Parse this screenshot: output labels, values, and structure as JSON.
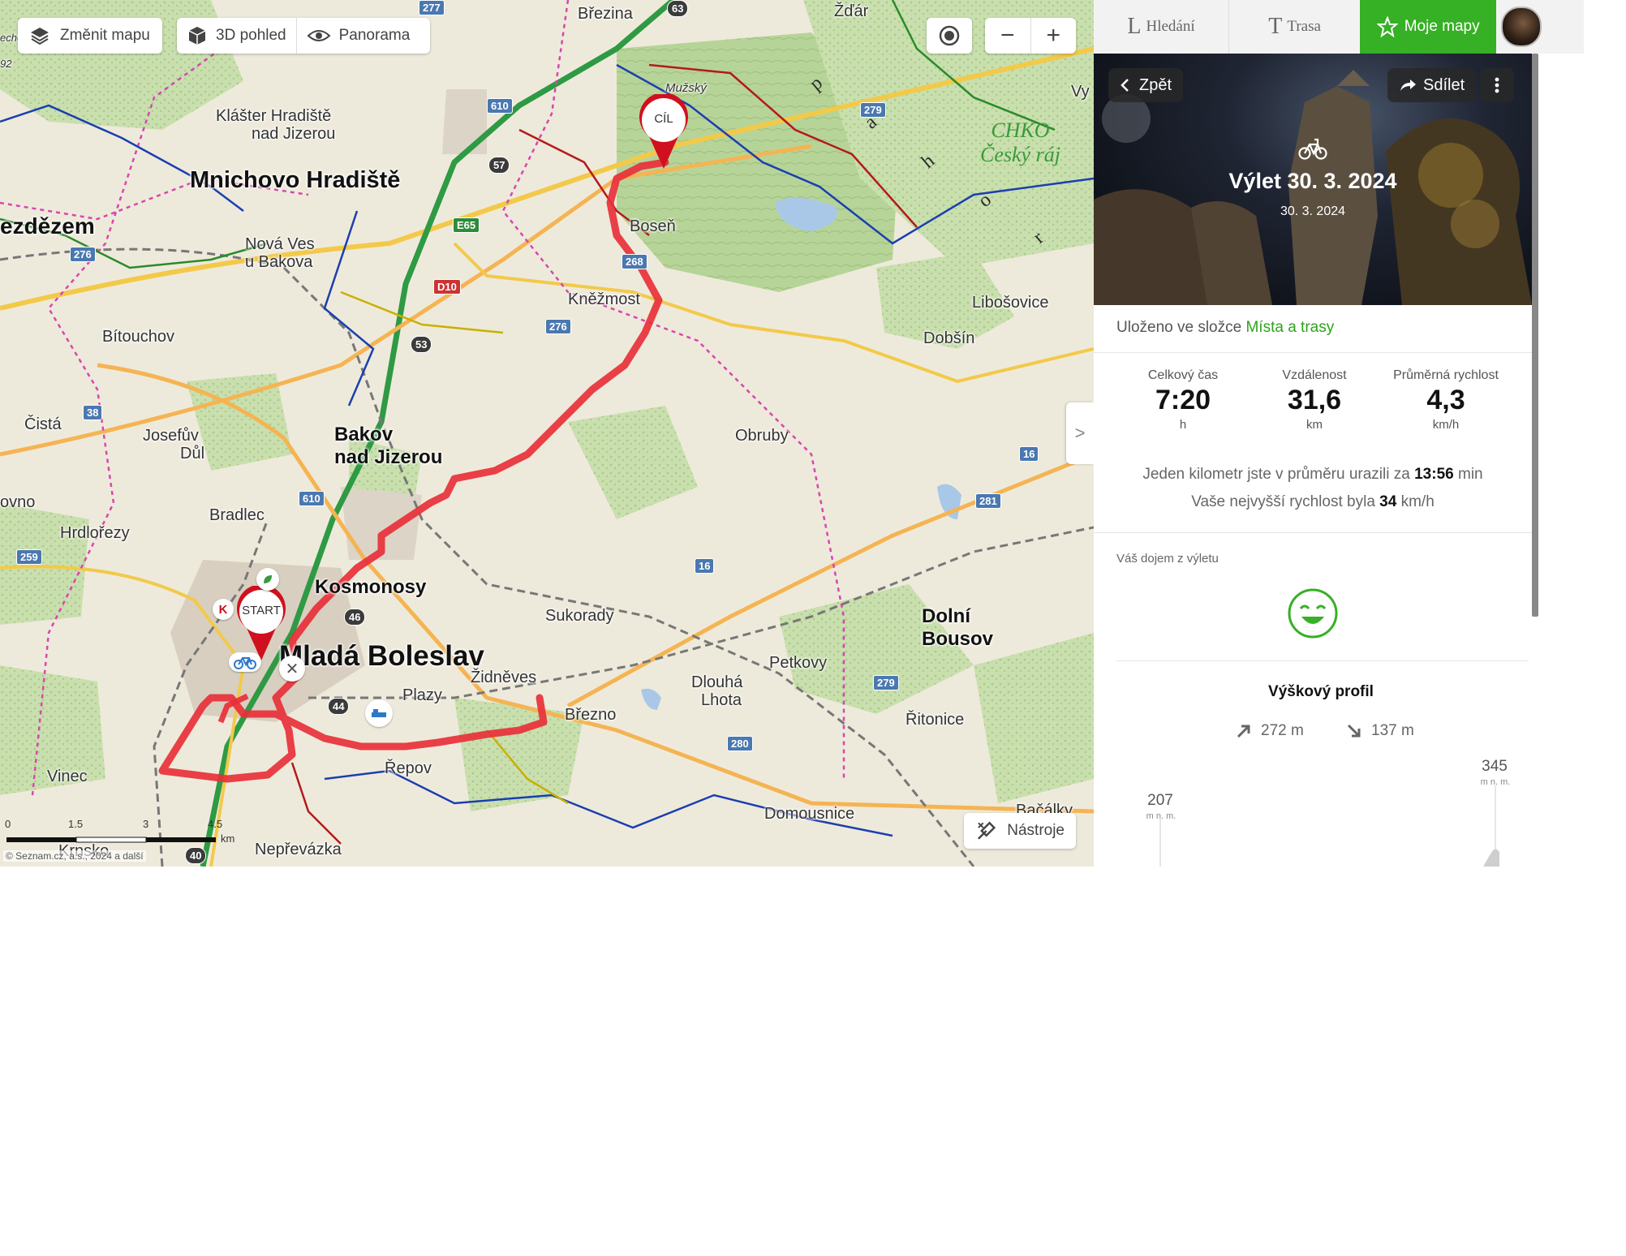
{
  "map": {
    "toolbar": {
      "change_map": "Změnit mapu",
      "view_3d": "3D pohled",
      "panorama": "Panorama"
    },
    "zoom": {
      "minus": "−",
      "plus": "+"
    },
    "tools_button": "Nástroje",
    "expand_panel": ">",
    "copyright": "© Seznam.cz, a.s., 2024 a další",
    "scale": {
      "labels": [
        "0",
        "1.5",
        "3",
        "4.5"
      ],
      "unit": "km"
    },
    "markers": {
      "start": "START",
      "end": "CÍL"
    },
    "places": {
      "brezina": "Březina",
      "zdar": "Žďár",
      "vy": "Vy",
      "muzsky": "Mužský",
      "klaster": "Klášter Hradiště",
      "klaster2": "nad Jizerou",
      "mnichovo": "Mnichovo Hradiště",
      "bezdezem": "ezdězem",
      "nova_ves": "Nová Ves",
      "nova_ves2": "u Bakova",
      "bosen": "Boseň",
      "knezmost": "Kněžmost",
      "libosovice": "Libošovice",
      "dobsin": "Dobšín",
      "bitouchov": "Bítouchov",
      "cista": "Čistá",
      "josefuv": "Josefův",
      "josefuv2": "Důl",
      "bakov": "Bakov",
      "bakov2": "nad Jizerou",
      "obruby": "Obruby",
      "kovno": "ovno",
      "hrdlorezy": "Hrdlořezy",
      "bradlec": "Bradlec",
      "kosmonosy": "Kosmonosy",
      "sukorady": "Sukorady",
      "dolni": "Dolní",
      "dolni2": "Bousov",
      "mlada": "Mladá Boleslav",
      "zidneves": "Židněves",
      "petkovy": "Petkovy",
      "dlouha": "Dlouhá",
      "dlouha2": "Lhota",
      "plazy": "Plazy",
      "brezno": "Březno",
      "ritonice": "Řitonice",
      "vinec": "Vinec",
      "repov": "Řepov",
      "domousnice": "Domousnice",
      "bacalky": "Bačálky",
      "krnsko": "Krnsko",
      "neprevazka": "Nepřevázka",
      "chko": "CHKO",
      "cesky_raj": "Český ráj",
      "mapy_letter_p": "p",
      "mapy_letter_a": "a",
      "mapy_letter_h": "h",
      "mapy_letter_o": "o",
      "mapy_letter_r": "r",
      "eche": "eche",
      "ninety_two": "92"
    },
    "road_numbers": {
      "r63": "63",
      "r277": "277",
      "r610a": "610",
      "r57": "57",
      "r279a": "279",
      "r276a": "276",
      "e65": "E65",
      "d10": "D10",
      "r268": "268",
      "r276b": "276",
      "r53": "53",
      "r38": "38",
      "r610b": "610",
      "r16a": "16",
      "r281": "281",
      "r259": "259",
      "r16b": "16",
      "r46": "46",
      "r44": "44",
      "r279b": "279",
      "r280": "280",
      "r40": "40"
    }
  },
  "sidebar": {
    "nav": {
      "search": "Hledání",
      "search_glyph": "L",
      "route": "Trasa",
      "route_glyph": "T",
      "my_maps": "Moje mapy"
    },
    "hero": {
      "back": "Zpět",
      "share": "Sdílet",
      "title": "Výlet 30. 3. 2024",
      "date": "30. 3. 2024"
    },
    "saved_prefix": "Uloženo ve složce",
    "saved_folder": "Místa a trasy",
    "stats": [
      {
        "label": "Celkový čas",
        "value": "7:20",
        "unit": "h"
      },
      {
        "label": "Vzdálenost",
        "value": "31,6",
        "unit": "km"
      },
      {
        "label": "Průměrná rychlost",
        "value": "4,3",
        "unit": "km/h"
      }
    ],
    "summary": {
      "line1_prefix": "Jeden kilometr jste v průměru urazili za",
      "line1_value": "13:56",
      "line1_suffix": "min",
      "line2_prefix": "Vaše nejvyšší rychlost byla",
      "line2_value": "34",
      "line2_suffix": "km/h"
    },
    "impression_label": "Váš dojem z výletu",
    "elevation": {
      "title": "Výškový profil",
      "ascent": "272 m",
      "descent": "137 m",
      "min_value": "207",
      "max_value": "345",
      "unit": "m n. m."
    }
  },
  "colors": {
    "accent": "#36b024",
    "route": "#e8303a",
    "marker": "#d0101e"
  }
}
